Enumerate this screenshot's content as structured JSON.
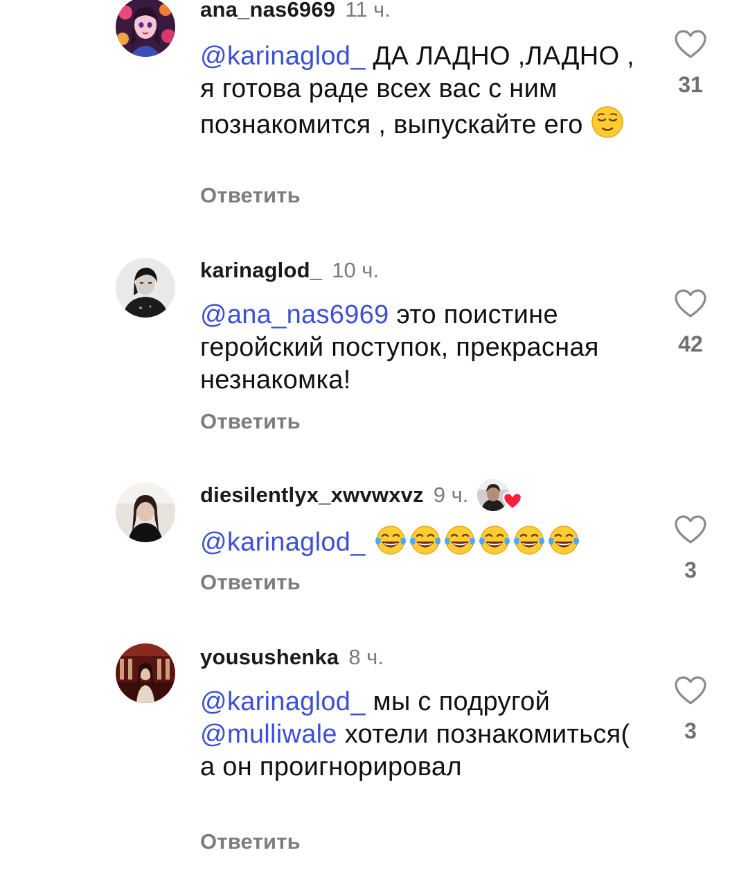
{
  "colors": {
    "mention": "#3b4fd9",
    "secondary_text": "#7a7a7a",
    "reply_text": "#7d7d7d",
    "badge_heart": "#ff1f3d"
  },
  "comments": [
    {
      "username": "ana_nas6969",
      "time": "11 ч.",
      "text_parts": [
        {
          "type": "mention",
          "text": "@karinaglod_"
        },
        {
          "type": "text",
          "text": " ДА ЛАДНО ,ЛАДНО , я готова раде всех вас с ним познакомится , выпускайте его "
        },
        {
          "type": "emoji",
          "icon": "relieved-face-emoji"
        }
      ],
      "reply_label": "Ответить",
      "like_count": "31"
    },
    {
      "username": "karinaglod_",
      "time": "10 ч.",
      "text_parts": [
        {
          "type": "mention",
          "text": "@ana_nas6969"
        },
        {
          "type": "text",
          "text": " это поистине геройский поступок, прекрасная незнакомка!"
        }
      ],
      "reply_label": "Ответить",
      "like_count": "42"
    },
    {
      "username": "diesilentlyx_xwvwxvz",
      "time": "9 ч.",
      "creator_liked": true,
      "text_parts": [
        {
          "type": "mention",
          "text": "@karinaglod_"
        },
        {
          "type": "text",
          "text": " "
        },
        {
          "type": "emoji",
          "icon": "tears-of-joy-emoji"
        },
        {
          "type": "emoji",
          "icon": "tears-of-joy-emoji"
        },
        {
          "type": "emoji",
          "icon": "tears-of-joy-emoji"
        },
        {
          "type": "emoji",
          "icon": "tears-of-joy-emoji"
        },
        {
          "type": "emoji",
          "icon": "tears-of-joy-emoji"
        },
        {
          "type": "emoji",
          "icon": "tears-of-joy-emoji"
        }
      ],
      "reply_label": "Ответить",
      "like_count": "3"
    },
    {
      "username": "yousushenka",
      "time": "8 ч.",
      "text_parts": [
        {
          "type": "mention",
          "text": "@karinaglod_"
        },
        {
          "type": "text",
          "text": " мы с подругой "
        },
        {
          "type": "mention",
          "text": "@mulliwale"
        },
        {
          "type": "text",
          "text": " хотели познакомиться( а он проигнорировал"
        }
      ],
      "reply_label": "Ответить",
      "like_count": "3"
    }
  ]
}
